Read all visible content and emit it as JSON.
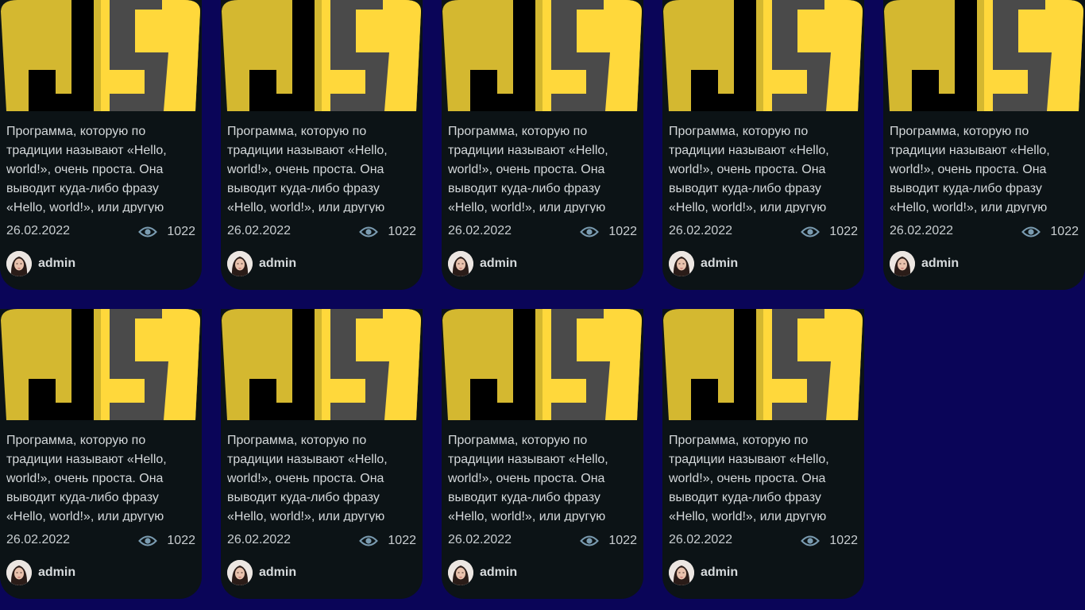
{
  "cards": [
    {
      "excerpt": "Программа, которую по традиции называют «Hello, world!», очень проста. Она выводит куда-либо фразу «Hello, world!», или другую",
      "date": "26.02.2022",
      "views": "1022",
      "author": "admin"
    },
    {
      "excerpt": "Программа, которую по традиции называют «Hello, world!», очень проста. Она выводит куда-либо фразу «Hello, world!», или другую",
      "date": "26.02.2022",
      "views": "1022",
      "author": "admin"
    },
    {
      "excerpt": "Программа, которую по традиции называют «Hello, world!», очень проста. Она выводит куда-либо фразу «Hello, world!», или другую",
      "date": "26.02.2022",
      "views": "1022",
      "author": "admin"
    },
    {
      "excerpt": "Программа, которую по традиции называют «Hello, world!», очень проста. Она выводит куда-либо фразу «Hello, world!», или другую",
      "date": "26.02.2022",
      "views": "1022",
      "author": "admin"
    },
    {
      "excerpt": "Программа, которую по традиции называют «Hello, world!», очень проста. Она выводит куда-либо фразу «Hello, world!», или другую",
      "date": "26.02.2022",
      "views": "1022",
      "author": "admin"
    },
    {
      "excerpt": "Программа, которую по традиции называют «Hello, world!», очень проста. Она выводит куда-либо фразу «Hello, world!», или другую",
      "date": "26.02.2022",
      "views": "1022",
      "author": "admin"
    },
    {
      "excerpt": "Программа, которую по традиции называют «Hello, world!», очень проста. Она выводит куда-либо фразу «Hello, world!», или другую",
      "date": "26.02.2022",
      "views": "1022",
      "author": "admin"
    },
    {
      "excerpt": "Программа, которую по традиции называют «Hello, world!», очень проста. Она выводит куда-либо фразу «Hello, world!», или другую",
      "date": "26.02.2022",
      "views": "1022",
      "author": "admin"
    },
    {
      "excerpt": "Программа, которую по традиции называют «Hello, world!», очень проста. Она выводит куда-либо фразу «Hello, world!», или другую",
      "date": "26.02.2022",
      "views": "1022",
      "author": "admin"
    }
  ],
  "icons": {
    "views": "eye-icon",
    "thumbnail": "javascript-logo",
    "avatar": "user-avatar"
  },
  "colors": {
    "page_background": "#0a0558",
    "card_background": "#0c1316",
    "js_yellow": "#ffd83b",
    "js_dark_yellow": "#d4b830",
    "js_gray": "#4a4a4a",
    "eye_icon": "#7a9bb0"
  }
}
